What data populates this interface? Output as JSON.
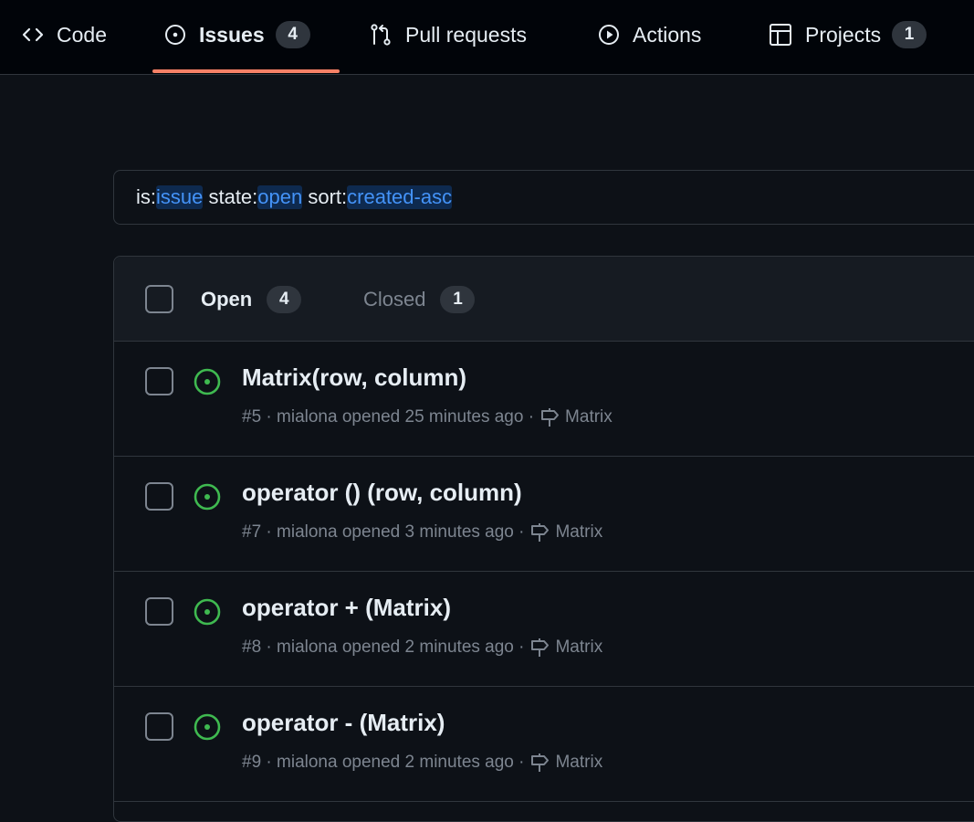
{
  "repo_nav": {
    "tabs": [
      {
        "label": "Code",
        "icon": "code-icon"
      },
      {
        "label": "Issues",
        "icon": "issue-opened-icon",
        "counter": "4",
        "active": true
      },
      {
        "label": "Pull requests",
        "icon": "git-pull-request-icon"
      },
      {
        "label": "Actions",
        "icon": "play-icon"
      },
      {
        "label": "Projects",
        "icon": "table-icon",
        "counter": "1"
      }
    ]
  },
  "search": {
    "segments": [
      {
        "text": "is:",
        "highlight": false
      },
      {
        "text": "issue",
        "highlight": true
      },
      {
        "text": " state:",
        "highlight": false
      },
      {
        "text": "open",
        "highlight": true
      },
      {
        "text": " sort:",
        "highlight": false
      },
      {
        "text": "created-asc",
        "highlight": true
      }
    ]
  },
  "issues_header": {
    "open_label": "Open",
    "open_count": "4",
    "closed_label": "Closed",
    "closed_count": "1"
  },
  "issues": [
    {
      "title": "Matrix(row, column)",
      "meta": "#5 · mialona opened 25 minutes ago ·",
      "milestone": "Matrix"
    },
    {
      "title": "operator () (row, column)",
      "meta": "#7 · mialona opened 3 minutes ago ·",
      "milestone": "Matrix"
    },
    {
      "title": "operator + (Matrix)",
      "meta": "#8 · mialona opened 2 minutes ago ·",
      "milestone": "Matrix"
    },
    {
      "title": "operator - (Matrix)",
      "meta": "#9 · mialona opened 2 minutes ago ·",
      "milestone": "Matrix"
    }
  ],
  "colors": {
    "background": "#0d1117",
    "nav_background": "#010409",
    "border": "#30363d",
    "accent_underline": "#f78166",
    "open_state": "#3fb950",
    "link_highlight": "#4493f8",
    "muted_text": "#7d8590"
  }
}
